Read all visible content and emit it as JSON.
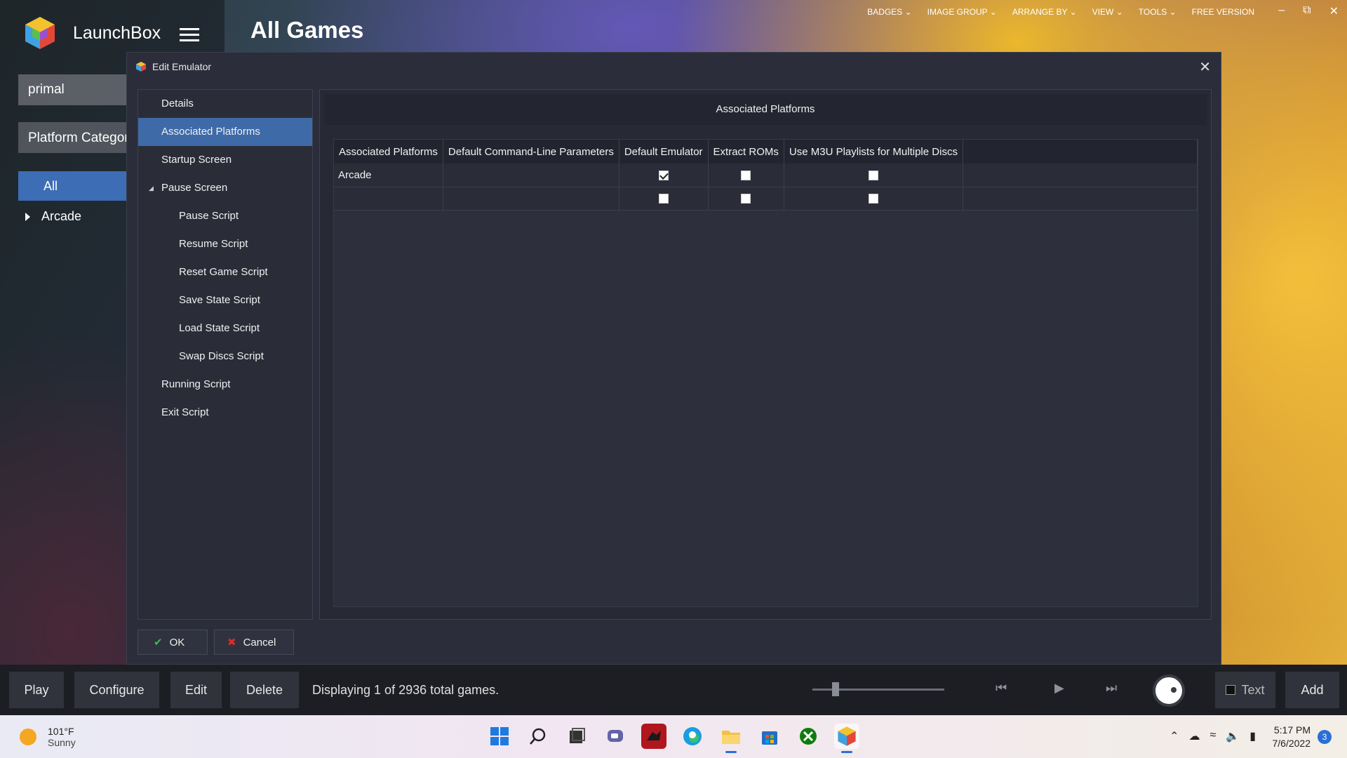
{
  "app": {
    "name": "LaunchBox",
    "page_title": "All Games",
    "search_value": "primal",
    "filter_label": "Platform Category",
    "tree": {
      "selected": "All",
      "items": [
        "Arcade"
      ]
    },
    "top_menu": [
      "BADGES",
      "IMAGE GROUP",
      "ARRANGE BY",
      "VIEW",
      "TOOLS",
      "FREE VERSION"
    ],
    "window_controls": {
      "minimize": "–",
      "restore": "⧉",
      "close": "✕"
    }
  },
  "dialog": {
    "title": "Edit Emulator",
    "close_glyph": "✕",
    "nav": [
      {
        "label": "Details",
        "level": 0
      },
      {
        "label": "Associated Platforms",
        "level": 0,
        "active": true
      },
      {
        "label": "Startup Screen",
        "level": 0
      },
      {
        "label": "Pause Screen",
        "level": 0,
        "expanded": true
      },
      {
        "label": "Pause Script",
        "level": 1
      },
      {
        "label": "Resume Script",
        "level": 1
      },
      {
        "label": "Reset Game Script",
        "level": 1
      },
      {
        "label": "Save State Script",
        "level": 1
      },
      {
        "label": "Load State Script",
        "level": 1
      },
      {
        "label": "Swap Discs Script",
        "level": 1
      },
      {
        "label": "Running Script",
        "level": 0
      },
      {
        "label": "Exit Script",
        "level": 0
      }
    ],
    "section_header": "Associated Platforms",
    "table": {
      "columns": [
        "Associated Platforms",
        "Default Command-Line Parameters",
        "Default Emulator",
        "Extract ROMs",
        "Use M3U Playlists for Multiple Discs"
      ],
      "rows": [
        {
          "platform": "Arcade",
          "params": "",
          "default_emulator": true,
          "extract_roms": false,
          "use_m3u": false
        },
        {
          "platform": "",
          "params": "",
          "default_emulator": false,
          "extract_roms": false,
          "use_m3u": false
        }
      ]
    },
    "ok_label": "OK",
    "cancel_label": "Cancel"
  },
  "bottom_bar": {
    "play": "Play",
    "configure": "Configure",
    "edit": "Edit",
    "delete": "Delete",
    "status": "Displaying 1 of 2936 total games.",
    "text_toggle": "Text",
    "add": "Add"
  },
  "taskbar": {
    "weather_temp": "101°F",
    "weather_condition": "Sunny",
    "time": "5:17 PM",
    "date": "7/6/2022",
    "notification_count": "3"
  },
  "colors": {
    "accent": "#3f6aa8",
    "dialog_bg": "#2b2e3a",
    "taskbar_accent": "#2b6fd6"
  }
}
